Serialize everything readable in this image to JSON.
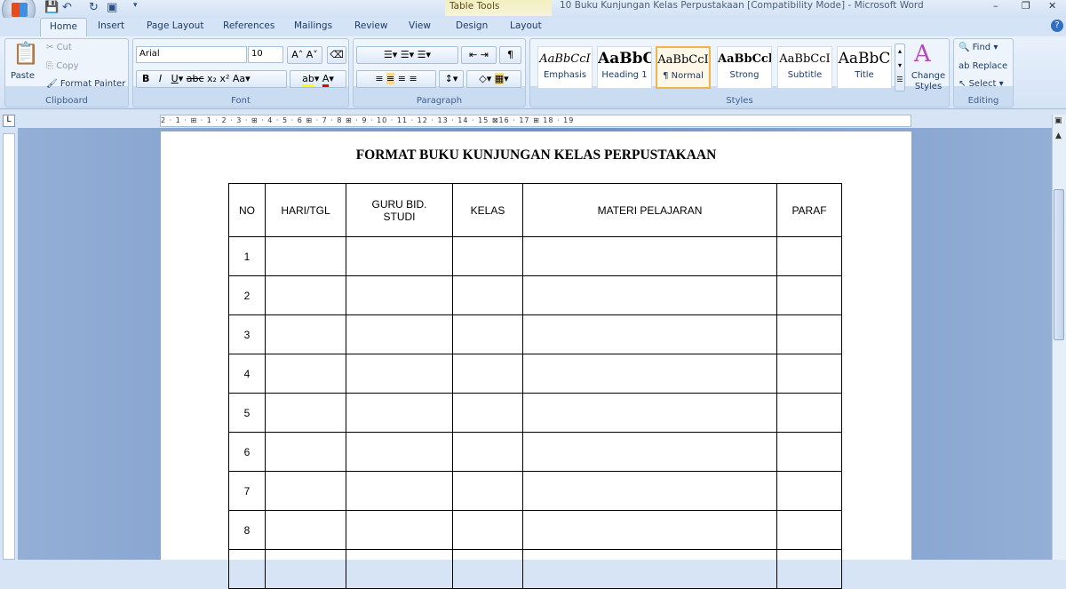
{
  "window": {
    "title": "10 Buku Kunjungan Kelas Perpustakaan [Compatibility Mode] - Microsoft Word",
    "context_tab": "Table Tools"
  },
  "tabs": [
    "Home",
    "Insert",
    "Page Layout",
    "References",
    "Mailings",
    "Review",
    "View",
    "Design",
    "Layout"
  ],
  "clipboard": {
    "label": "Clipboard",
    "paste": "Paste",
    "cut": "Cut",
    "copy": "Copy",
    "format_painter": "Format Painter"
  },
  "font": {
    "label": "Font",
    "family": "Arial",
    "size": "10"
  },
  "paragraph": {
    "label": "Paragraph"
  },
  "styles": {
    "label": "Styles",
    "items": [
      {
        "preview": "AaBbCcI",
        "name": "Emphasis"
      },
      {
        "preview": "AaBbC",
        "name": "Heading 1"
      },
      {
        "preview": "AaBbCcI",
        "name": "¶ Normal"
      },
      {
        "preview": "AaBbCcl",
        "name": "Strong"
      },
      {
        "preview": "AaBbCcI",
        "name": "Subtitle"
      },
      {
        "preview": "AaBbC",
        "name": "Title"
      }
    ],
    "change_styles": "Change Styles"
  },
  "editing": {
    "label": "Editing",
    "find": "Find",
    "replace": "Replace",
    "select": "Select"
  },
  "ruler": "2 · 1 · ⊞ · 1 · 2 · 3 · ⊞ · 4 · 5 · 6 ⊞ · 7 · 8 ⊞ · 9 · 10 · 11 · 12 · 13 · 14 · 15 ⊠16 · 17 ⊞ 18 · 19",
  "document": {
    "title": "FORMAT BUKU KUNJUNGAN KELAS PERPUSTAKAAN",
    "headers": [
      "NO",
      "HARI/TGL",
      "GURU BID. STUDI",
      "KELAS",
      "MATERI PELAJARAN",
      "PARAF"
    ],
    "rows": [
      "1",
      "2",
      "3",
      "4",
      "5",
      "6",
      "7",
      "8",
      ""
    ]
  }
}
